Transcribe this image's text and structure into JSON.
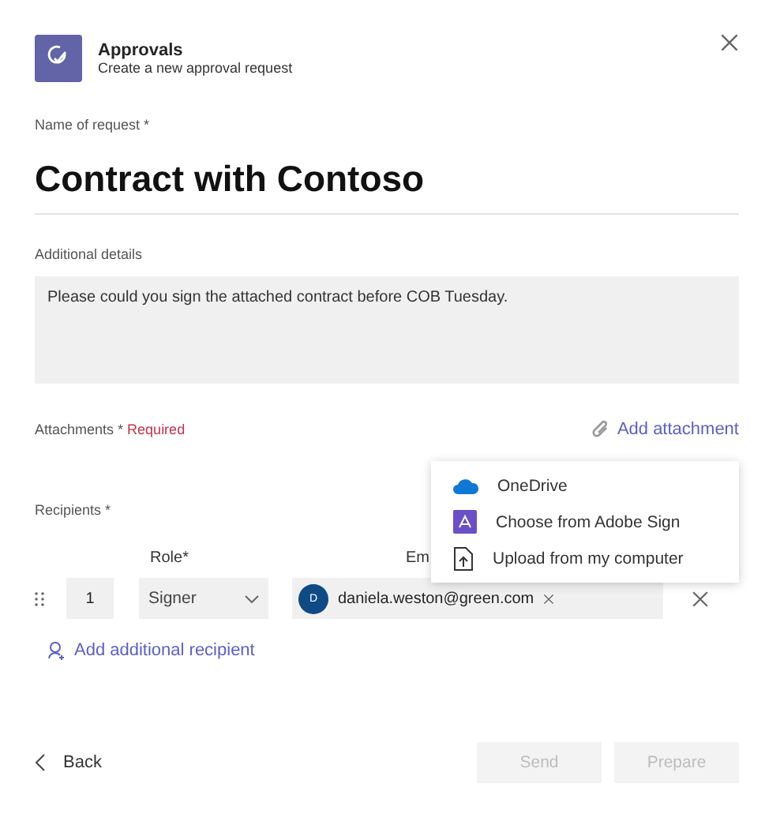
{
  "header": {
    "title": "Approvals",
    "subtitle": "Create a new approval request"
  },
  "name_field": {
    "label": "Name of request *",
    "value": "Contract with Contoso"
  },
  "details_field": {
    "label": "Additional details",
    "value": "Please could you sign the attached contract before COB Tuesday."
  },
  "attachments": {
    "label": "Attachments *",
    "required": "Required",
    "add_label": "Add attachment"
  },
  "attachment_menu": [
    {
      "kind": "cloud",
      "label": "OneDrive"
    },
    {
      "kind": "adobe",
      "label": "Choose from Adobe Sign"
    },
    {
      "kind": "upload",
      "label": "Upload from my computer"
    }
  ],
  "recipients": {
    "label": "Recipients *",
    "columns": [
      "Role*",
      "Em"
    ],
    "rows": [
      {
        "order": "1",
        "role": "Signer",
        "avatar": "D",
        "email": "daniela.weston@green.com"
      }
    ],
    "add_label": "Add additional recipient"
  },
  "footer": {
    "back": "Back",
    "buttons": [
      {
        "label": "Send",
        "disabled": true
      },
      {
        "label": "Prepare",
        "disabled": true
      }
    ]
  }
}
